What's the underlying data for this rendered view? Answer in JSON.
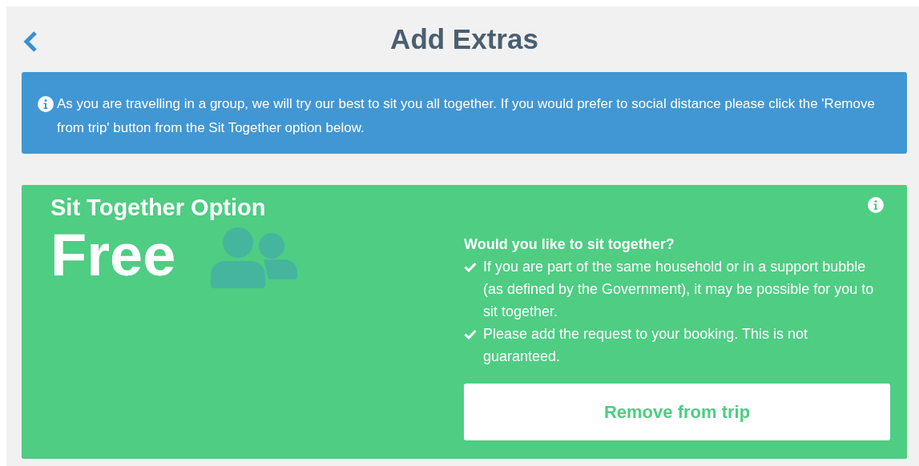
{
  "header": {
    "title": "Add Extras"
  },
  "notice": {
    "text": "As you are travelling in a group, we will try our best to sit you all together. If you would prefer to social distance please click the 'Remove from trip' button from the Sit Together option below."
  },
  "option": {
    "title": "Sit Together Option",
    "price": "Free",
    "question": "Would you like to sit together?",
    "points": [
      "If you are part of the same household or in a support bubble (as defined by the Government), it may be possible for you to sit together.",
      "Please add the request to your booking. This is not guaranteed."
    ],
    "button": "Remove from trip"
  }
}
